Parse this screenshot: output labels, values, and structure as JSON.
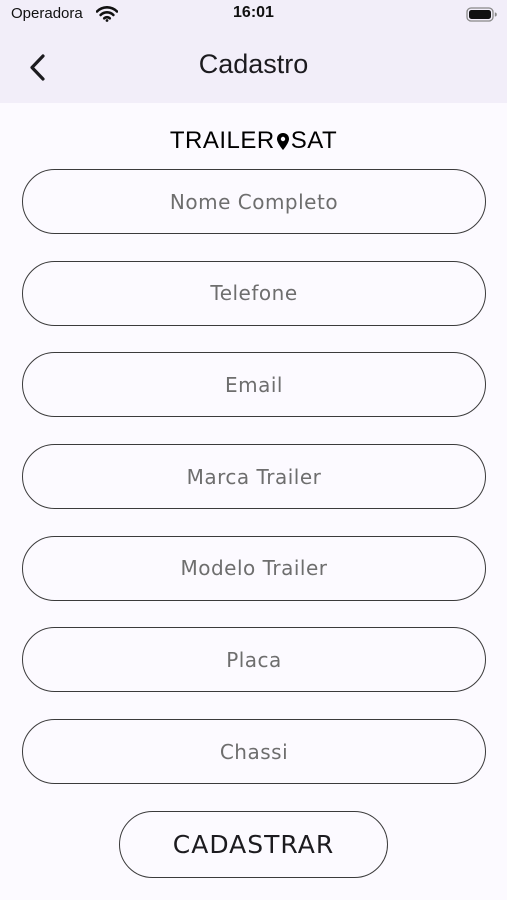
{
  "status_bar": {
    "carrier": "Operadora",
    "time": "16:01"
  },
  "header": {
    "title": "Cadastro"
  },
  "logo": {
    "left_text": "TRAILER",
    "right_text": "SAT"
  },
  "form": {
    "fields": [
      {
        "placeholder": "Nome Completo",
        "value": ""
      },
      {
        "placeholder": "Telefone",
        "value": ""
      },
      {
        "placeholder": "Email",
        "value": ""
      },
      {
        "placeholder": "Marca Trailer",
        "value": ""
      },
      {
        "placeholder": "Modelo Trailer",
        "value": ""
      },
      {
        "placeholder": "Placa",
        "value": ""
      },
      {
        "placeholder": "Chassi",
        "value": ""
      }
    ],
    "submit_label": "CADASTRAR"
  },
  "icons": {
    "back": "chevron-left-icon",
    "wifi": "wifi-icon",
    "battery": "battery-icon",
    "logo_pin": "location-pin-icon"
  },
  "colors": {
    "header_background": "#f2eef9",
    "page_background": "#fcfaff",
    "border": "#3b3b3b"
  }
}
